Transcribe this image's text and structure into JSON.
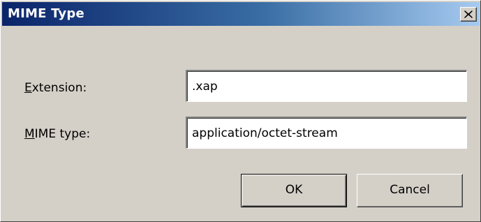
{
  "window": {
    "title": "MIME Type"
  },
  "titlebar": {
    "close_icon": "close-x-icon"
  },
  "form": {
    "extension": {
      "label_accel": "E",
      "label_rest": "xtension:",
      "value": ".xap"
    },
    "mime_type": {
      "label_accel": "M",
      "label_rest": "IME type:",
      "value": "application/octet-stream"
    }
  },
  "buttons": {
    "ok_label": "OK",
    "cancel_label": "Cancel"
  }
}
